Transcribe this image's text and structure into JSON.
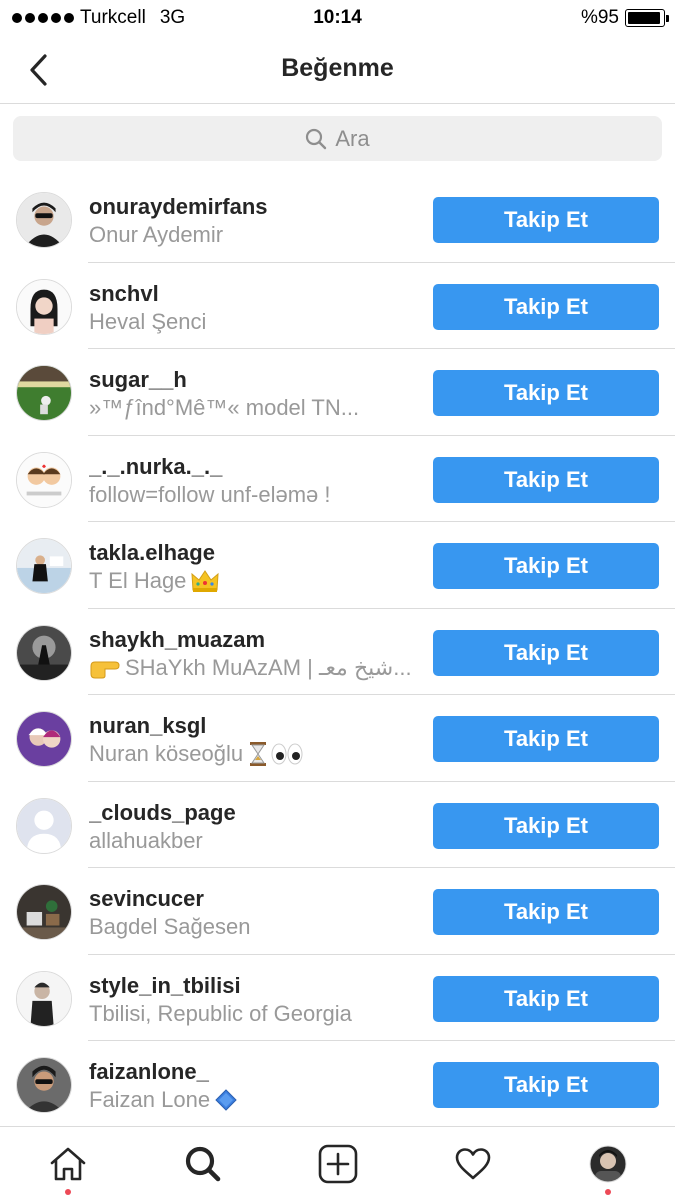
{
  "status_bar": {
    "carrier": "Turkcell",
    "network": "3G",
    "time": "10:14",
    "battery_text": "%95",
    "battery_level": 0.95
  },
  "header": {
    "title": "Beğenme",
    "back_icon": "chevron-left-icon"
  },
  "search": {
    "placeholder": "Ara",
    "icon": "search-icon"
  },
  "follow_label": "Takip Et",
  "users": [
    {
      "username": "onuraydemirfans",
      "fullname": "Onur Aydemir",
      "emoji": ""
    },
    {
      "username": "snchvl",
      "fullname": "Heval Şenci",
      "emoji": ""
    },
    {
      "username": "sugar__h",
      "fullname": "»™ƒînd°Mê™«  model TN...",
      "emoji": ""
    },
    {
      "username": "_._.nurka._._",
      "fullname": "follow=follow unf-eləmə !",
      "emoji": ""
    },
    {
      "username": "takla.elhage",
      "fullname": "T El Hage",
      "emoji": "crown-emoji"
    },
    {
      "username": "shaykh_muazam",
      "fullname": "SHaYkh MuAzAM | شيخ معـ...",
      "emoji": "pointing-hand-emoji"
    },
    {
      "username": "nuran_ksgl",
      "fullname": "Nuran köseoğlu",
      "emoji": "hourglass-eyes-emoji"
    },
    {
      "username": "_clouds_page",
      "fullname": "allahuakber",
      "emoji": ""
    },
    {
      "username": "sevincucer",
      "fullname": "Bagdel Sağesen",
      "emoji": ""
    },
    {
      "username": "style_in_tbilisi",
      "fullname": "Tbilisi, Republic of Georgia",
      "emoji": ""
    },
    {
      "username": "faizanlone_",
      "fullname": "Faizan Lone",
      "emoji": "blue-diamond-emoji"
    }
  ],
  "tab_bar": {
    "tabs": [
      "home-icon",
      "search-icon",
      "add-post-icon",
      "heart-icon",
      "profile-avatar"
    ],
    "active_tab": "search-icon",
    "notification_dots": [
      "home-icon",
      "profile-avatar"
    ],
    "accent_color": "#3897f0",
    "dot_color": "#ed4956"
  }
}
